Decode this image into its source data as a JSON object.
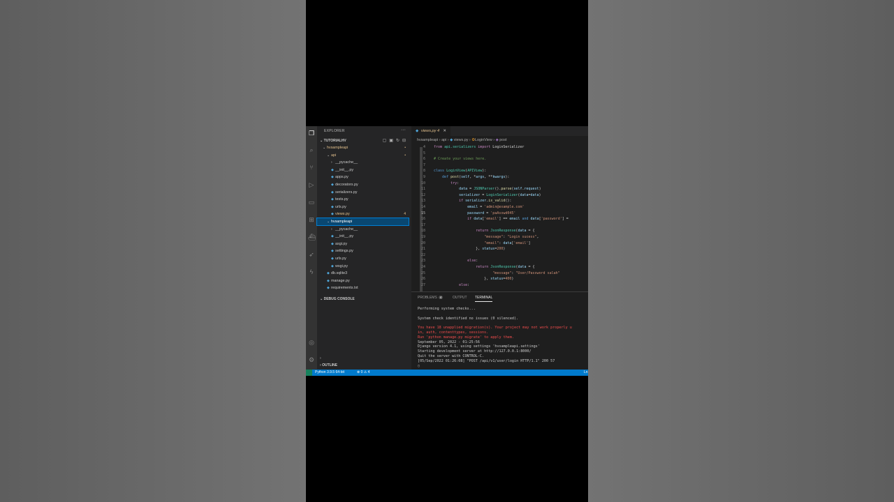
{
  "explorer": {
    "title": "EXPLORER",
    "more": "···",
    "workspace": "TUTORIALHV",
    "debug_console": "DEBUG CONSOLE",
    "outline": "OUTLINE",
    "tree": [
      {
        "label": "hvsampleapi",
        "type": "folder",
        "depth": 0,
        "open": true,
        "color": "#e2c08d",
        "badge": "•"
      },
      {
        "label": "api",
        "type": "folder",
        "depth": 1,
        "open": true,
        "color": "#e2c08d",
        "badge": "•"
      },
      {
        "label": "__pycache__",
        "type": "folder",
        "depth": 2,
        "open": false,
        "color": "#cccccc",
        "badge": ""
      },
      {
        "label": "__init__.py",
        "type": "file",
        "depth": 2,
        "color": "#cccccc",
        "badge": ""
      },
      {
        "label": "apps.py",
        "type": "file",
        "depth": 2,
        "color": "#cccccc",
        "badge": ""
      },
      {
        "label": "decorators.py",
        "type": "file",
        "depth": 2,
        "color": "#cccccc",
        "badge": ""
      },
      {
        "label": "serializers.py",
        "type": "file",
        "depth": 2,
        "color": "#cccccc",
        "badge": ""
      },
      {
        "label": "tests.py",
        "type": "file",
        "depth": 2,
        "color": "#cccccc",
        "badge": ""
      },
      {
        "label": "urls.py",
        "type": "file",
        "depth": 2,
        "color": "#cccccc",
        "badge": ""
      },
      {
        "label": "views.py",
        "type": "file",
        "depth": 2,
        "color": "#e2c08d",
        "badge": "4"
      },
      {
        "label": "hvsampleapi",
        "type": "folder",
        "depth": 1,
        "open": true,
        "color": "#ffffff",
        "badge": "",
        "selected": true
      },
      {
        "label": "__pycache__",
        "type": "folder",
        "depth": 2,
        "open": false,
        "color": "#cccccc",
        "badge": ""
      },
      {
        "label": "__init__.py",
        "type": "file",
        "depth": 2,
        "color": "#cccccc",
        "badge": ""
      },
      {
        "label": "asgi.py",
        "type": "file",
        "depth": 2,
        "color": "#cccccc",
        "badge": ""
      },
      {
        "label": "settings.py",
        "type": "file",
        "depth": 2,
        "color": "#cccccc",
        "badge": ""
      },
      {
        "label": "urls.py",
        "type": "file",
        "depth": 2,
        "color": "#cccccc",
        "badge": ""
      },
      {
        "label": "wsgi.py",
        "type": "file",
        "depth": 2,
        "color": "#cccccc",
        "badge": ""
      },
      {
        "label": "db.sqlite3",
        "type": "file",
        "depth": 1,
        "color": "#cccccc",
        "badge": ""
      },
      {
        "label": "manage.py",
        "type": "file",
        "depth": 1,
        "color": "#cccccc",
        "badge": ""
      },
      {
        "label": "requirements.txt",
        "type": "file",
        "depth": 1,
        "color": "#cccccc",
        "badge": ""
      }
    ]
  },
  "editor": {
    "tab": {
      "label": "views.py",
      "count": "4"
    },
    "breadcrumb": [
      "hvsampleapi",
      "api",
      "views.py",
      "LoginView",
      "post"
    ],
    "lines": [
      {
        "n": "4",
        "html": "<span class='ctl'>from</span> <span class='cls'>api.serializers</span> <span class='ctl'>import</span> LoginSerializer"
      },
      {
        "n": "5",
        "html": ""
      },
      {
        "n": "6",
        "html": "<span class='cm'># Create your views here.</span>"
      },
      {
        "n": "7",
        "html": ""
      },
      {
        "n": "8",
        "html": "<span class='kw'>class</span> <span class='cls'>LoginView</span>(<span class='cls'>APIView</span>):"
      },
      {
        "n": "9",
        "html": "    <span class='kw'>def</span> <span class='fn'>post</span>(<span class='vr'>self</span>, *<span class='vr'>args</span>, **<span class='vr'>kwargs</span>):"
      },
      {
        "n": "10",
        "html": "        <span class='ctl'>try</span>:"
      },
      {
        "n": "11",
        "html": "            <span class='vr'>data</span> = <span class='cls'>JSONParser</span>().<span class='fn'>parse</span>(<span class='vr'>self</span>.<span class='vr'>request</span>)"
      },
      {
        "n": "12",
        "html": "            <span class='vr'>serializer</span> = <span class='cls'>LoginSerializer</span>(<span class='vr'>data</span>=<span class='vr'>data</span>)"
      },
      {
        "n": "13",
        "html": "            <span class='ctl'>if</span> <span class='vr'>serializer</span>.<span class='fn'>is_valid</span>():"
      },
      {
        "n": "14",
        "html": "                <span class='vr'>email</span> = <span class='str'>'admin@example.com'</span>"
      },
      {
        "n": "15",
        "html": "                <span class='vr'>password</span> = <span class='str'>'paAsswd045'</span>"
      },
      {
        "n": "16",
        "html": "                <span class='ctl'>if</span> <span class='vr'>data</span>[<span class='str'>'email'</span>] == <span class='vr'>email</span> <span class='kw'>and</span> <span class='vr'>data</span>[<span class='str'>'password'</span>] ="
      },
      {
        "n": "17",
        "html": ""
      },
      {
        "n": "18",
        "html": "                    <span class='ctl'>return</span> <span class='cls'>JsonResponse</span>(<span class='vr'>data</span> = {"
      },
      {
        "n": "19",
        "html": "                        <span class='str'>\"message\"</span>: <span class='str'>\"Login sucess\"</span>,"
      },
      {
        "n": "20",
        "html": "                        <span class='str'>\"email\"</span>: <span class='vr'>data</span>[<span class='str'>'email'</span>]"
      },
      {
        "n": "21",
        "html": "                    }, <span class='vr'>status</span>=<span class='str'>200</span>)"
      },
      {
        "n": "22",
        "html": ""
      },
      {
        "n": "23",
        "html": "                <span class='ctl'>else</span>:"
      },
      {
        "n": "24",
        "html": "                    <span class='ctl'>return</span> <span class='cls'>JsonResponse</span>(<span class='vr'>data</span> = {"
      },
      {
        "n": "25",
        "html": "                            <span class='str'>\"message\"</span>: <span class='str'>\"User/Password salah\"</span>"
      },
      {
        "n": "26",
        "html": "                        }, <span class='vr'>status</span>=<span class='str'>400</span>)"
      },
      {
        "n": "27",
        "html": "            <span class='ctl'>else</span>:"
      }
    ],
    "current_line": "15"
  },
  "panel": {
    "tabs": [
      {
        "label": "PROBLEMS",
        "badge": "4",
        "active": false
      },
      {
        "label": "OUTPUT",
        "badge": "",
        "active": false
      },
      {
        "label": "TERMINAL",
        "badge": "",
        "active": true
      }
    ],
    "terminal": [
      {
        "text": "Performing system checks...",
        "red": false
      },
      {
        "text": "",
        "red": false
      },
      {
        "text": "System check identified no issues (0 silenced).",
        "red": false
      },
      {
        "text": "",
        "red": false
      },
      {
        "text": "You have 18 unapplied migration(s). Your project may not work properly u",
        "red": true
      },
      {
        "text": "in, auth, contenttypes, sessions.",
        "red": true
      },
      {
        "text": "Run 'python manage.py migrate' to apply them.",
        "red": true
      },
      {
        "text": "September 05, 2022 - 01:25:56",
        "red": false
      },
      {
        "text": "Django version 4.1, using settings 'hvsampleapi.settings'",
        "red": false
      },
      {
        "text": "Starting development server at http://127.0.0.1:8000/",
        "red": false
      },
      {
        "text": "Quit the server with CONTROL-C.",
        "red": false
      },
      {
        "text": "[05/Sep/2022 01:26:08] \"POST /api/v1/user/login HTTP/1.1\" 200 57",
        "red": false
      },
      {
        "text": "▯",
        "red": false
      }
    ]
  },
  "statusbar": {
    "python": "Python 3.9.5 64-bit",
    "errors": "⊗ 0 ⚠ 4",
    "right": "Ln"
  }
}
